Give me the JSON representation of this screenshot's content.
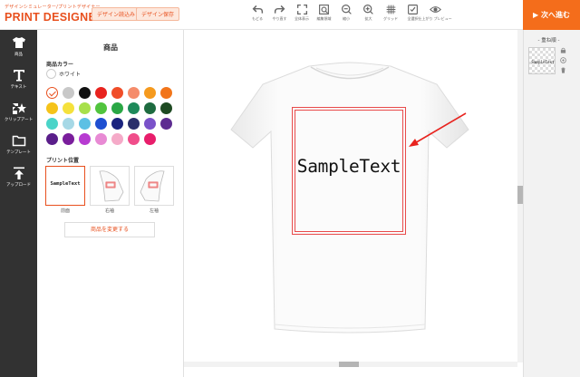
{
  "header": {
    "logo_sub": "デザインシミュレーター/プリントデザイナー",
    "logo_main": "PRINT DESIGNER",
    "load_design": "デザイン読込み",
    "save_design": "デザイン保存",
    "next_button": "▶ 次へ進む",
    "toolbar": [
      {
        "icon": "undo-icon",
        "label": "もどる"
      },
      {
        "icon": "redo-icon",
        "label": "やり直す"
      },
      {
        "icon": "fit-all-icon",
        "label": "全体表示"
      },
      {
        "icon": "edit-area-icon",
        "label": "編集領域"
      },
      {
        "icon": "zoom-out-icon",
        "label": "縮小"
      },
      {
        "icon": "zoom-in-icon",
        "label": "拡大"
      },
      {
        "icon": "grid-icon",
        "label": "グリッド"
      },
      {
        "icon": "select-all-icon",
        "label": "全選択"
      },
      {
        "icon": "preview-icon",
        "label": "仕上がり プレビュー"
      }
    ]
  },
  "sidebar": {
    "items": [
      {
        "icon": "tshirt-icon",
        "label": "商品"
      },
      {
        "icon": "text-icon",
        "label": "テキスト"
      },
      {
        "icon": "clipart-icon",
        "label": "クリップアート"
      },
      {
        "icon": "template-icon",
        "label": "テンプレート"
      },
      {
        "icon": "upload-icon",
        "label": "アップロード"
      }
    ]
  },
  "panel": {
    "title": "商品",
    "color_label": "商品カラー",
    "selected_color_name": "ホワイト",
    "colors": [
      "#ffffff",
      "#c8c8c8",
      "#111111",
      "#e8231e",
      "#f04d28",
      "#f58c6b",
      "#f59a1e",
      "#f2751a",
      "#f5c31a",
      "#f5e13c",
      "#a7e04b",
      "#51c43d",
      "#2aa745",
      "#1e8a5a",
      "#1e6b40",
      "#1e4a22",
      "#4ad4c8",
      "#a6d8e6",
      "#5cc0e4",
      "#1e4fd1",
      "#1a237e",
      "#2a2f6b",
      "#7a52c9",
      "#5d2c91",
      "#5a1e8a",
      "#7a1e9c",
      "#b73bd1",
      "#e88ad4",
      "#f5aac8",
      "#f04d8a",
      "#e81e6b"
    ],
    "print_position_label": "プリント位置",
    "positions": [
      {
        "label": "前面",
        "text": "SampleText"
      },
      {
        "label": "右袖"
      },
      {
        "label": "左袖"
      }
    ],
    "change_product_button": "商品を変更する"
  },
  "canvas": {
    "design_text": "SampleText"
  },
  "layers": {
    "title": "- 重ね順 -",
    "items": [
      {
        "text": "SampleText"
      }
    ]
  }
}
